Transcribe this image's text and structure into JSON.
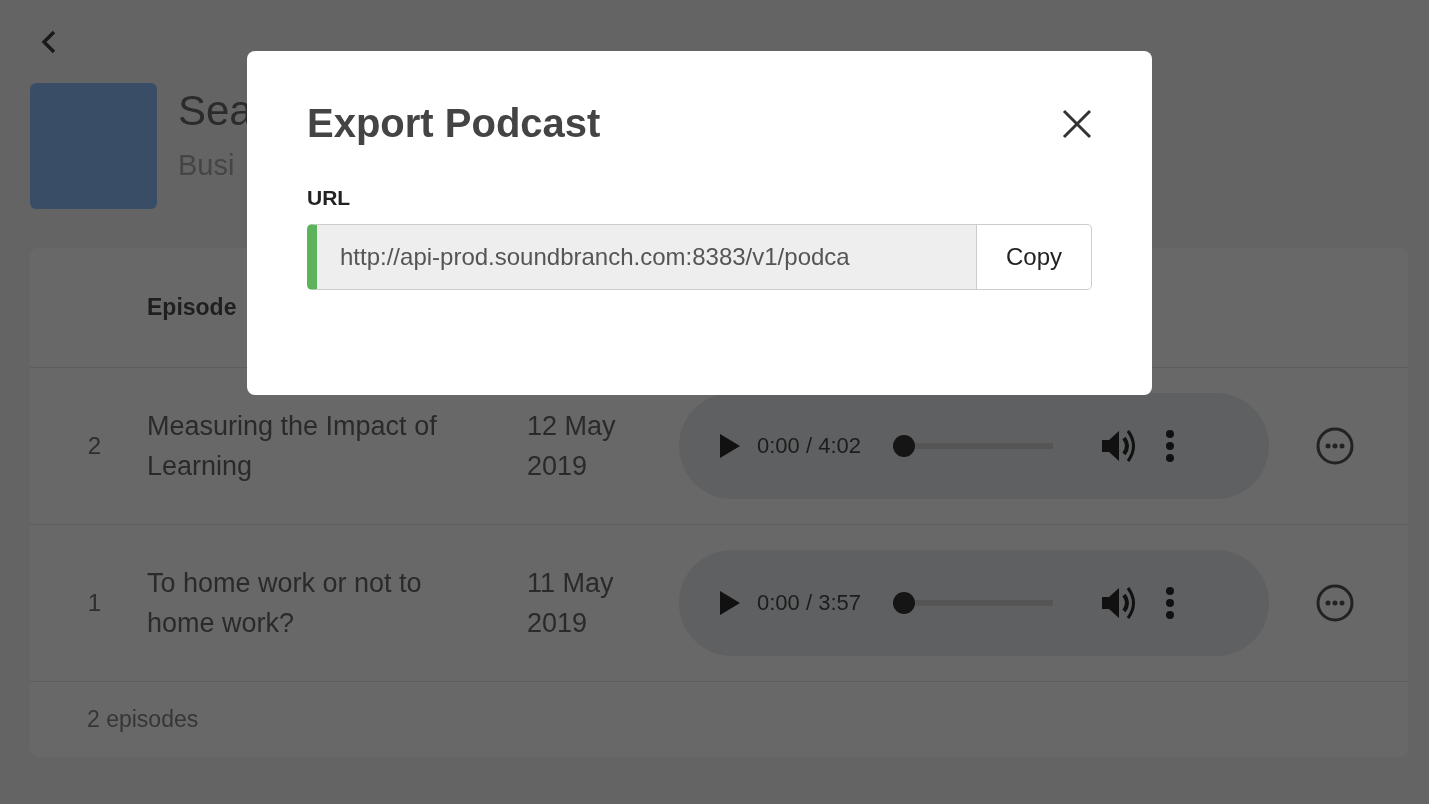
{
  "podcast": {
    "title": "Sea",
    "subtitle": "Busi"
  },
  "table": {
    "columns": [
      "Episode"
    ],
    "rows": [
      {
        "number": "2",
        "title": "Measuring the Impact of Learning",
        "date": "12 May 2019",
        "player": {
          "time": "0:00 / 4:02",
          "level": 0
        }
      },
      {
        "number": "1",
        "title": "To home work or not to home work?",
        "date": "11 May 2019",
        "player": {
          "time": "0:00 / 3:57",
          "level": 0
        }
      }
    ],
    "footer": "2 episodes"
  },
  "modal": {
    "title": "Export Podcast",
    "field_label": "URL",
    "url": "http://api-prod.soundbranch.com:8383/v1/podca",
    "copy_button": "Copy"
  }
}
